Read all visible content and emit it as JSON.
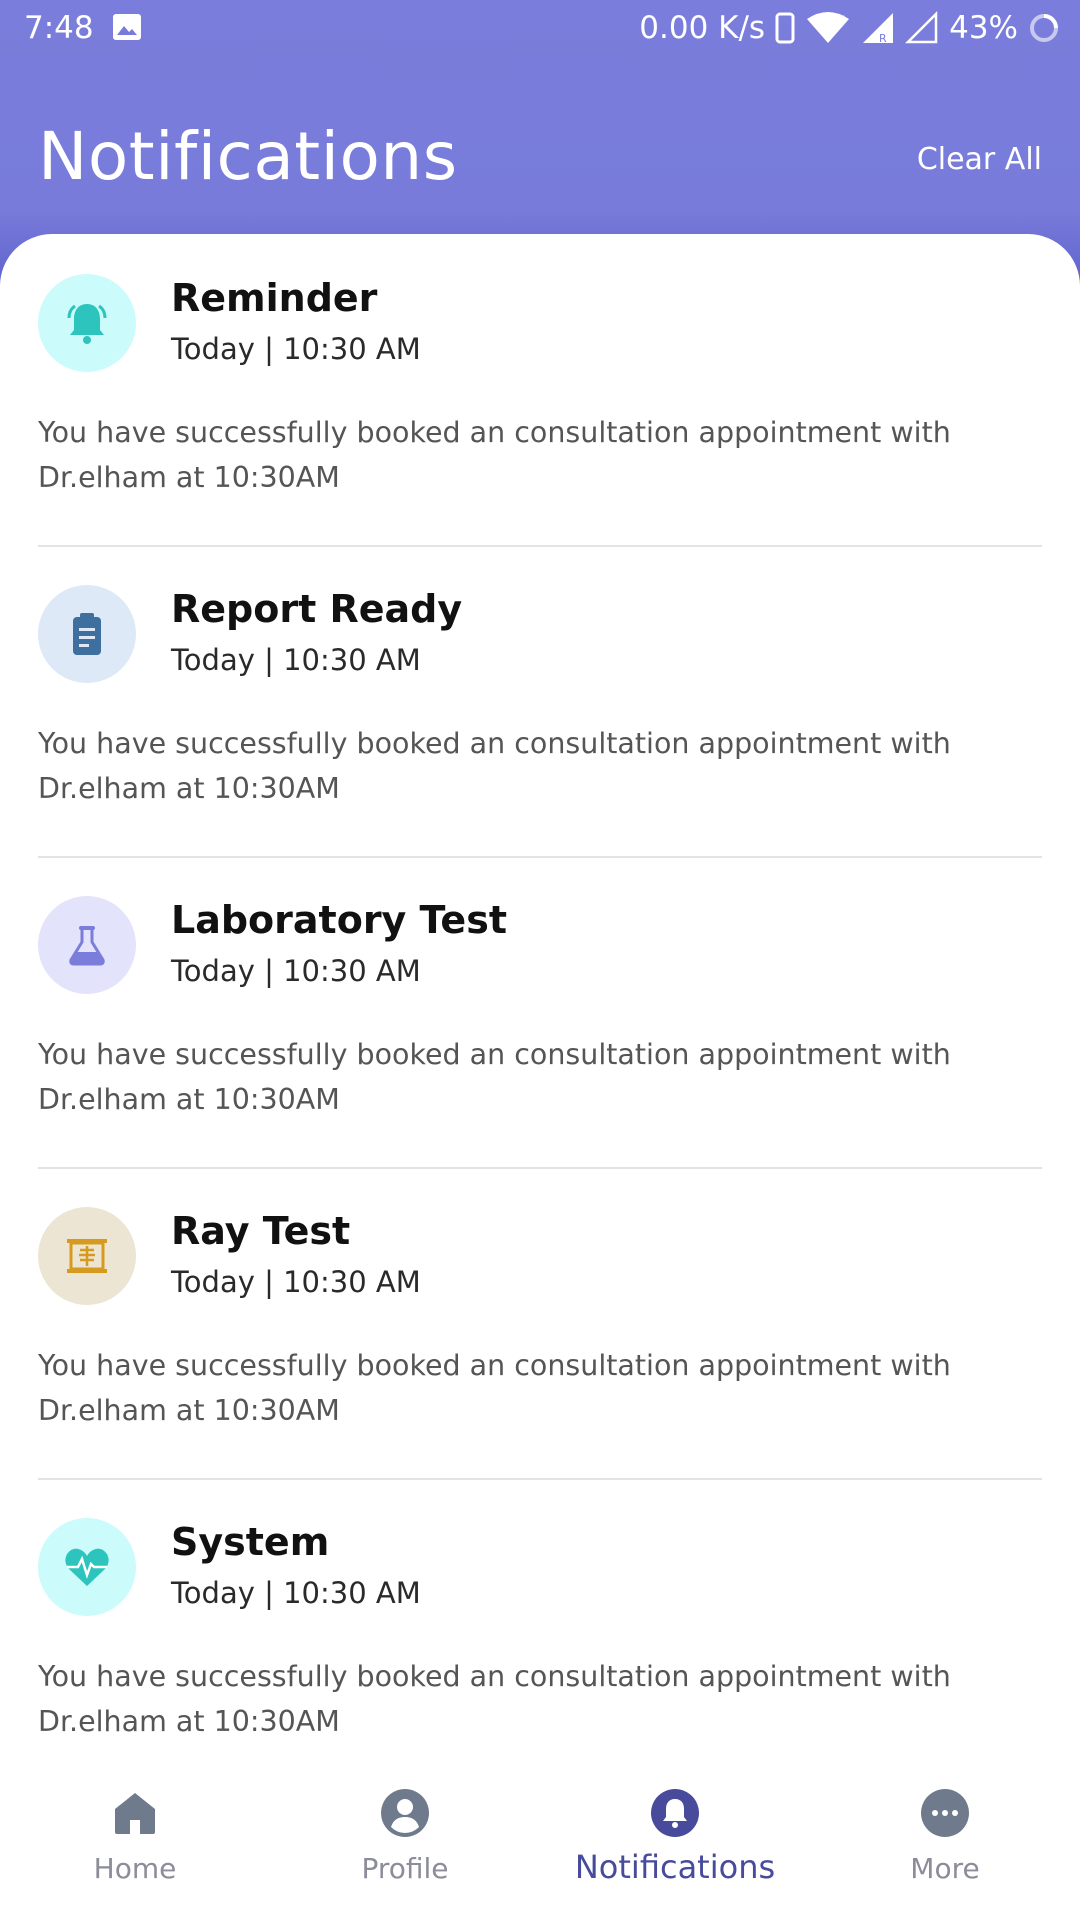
{
  "status_bar": {
    "time": "7:48",
    "speed": "0.00 K/s",
    "battery": "43%",
    "icons": [
      "gallery-icon",
      "phone-icon",
      "wifi-icon",
      "signal-icon",
      "signal-empty-icon",
      "loading-icon"
    ]
  },
  "header": {
    "title": "Notifications",
    "clear_all": "Clear All"
  },
  "colors": {
    "header": "#787bd9",
    "accent": "#484b9c",
    "inactive_tab": "#8c8c9a"
  },
  "notifications": [
    {
      "title": "Reminder",
      "time": "Today | 10:30 AM",
      "message": "You have successfully booked an consultation appointment with Dr.elham at 10:30AM",
      "icon": "bell-icon",
      "icon_bg": "#ccfbfb",
      "icon_color": "#2cc4bc"
    },
    {
      "title": "Report Ready",
      "time": "Today | 10:30 AM",
      "message": "You have successfully booked an consultation appointment with Dr.elham at 10:30AM",
      "icon": "clipboard-icon",
      "icon_bg": "#dde9f6",
      "icon_color": "#3e6f9e"
    },
    {
      "title": "Laboratory Test",
      "time": "Today | 10:30 AM",
      "message": "You have successfully booked an consultation appointment with Dr.elham at 10:30AM",
      "icon": "flask-icon",
      "icon_bg": "#e3e3fb",
      "icon_color": "#7b7ddb"
    },
    {
      "title": "Ray Test",
      "time": "Today | 10:30 AM",
      "message": "You have successfully booked an consultation appointment with Dr.elham at 10:30AM",
      "icon": "xray-icon",
      "icon_bg": "#ece5d3",
      "icon_color": "#d69a1e"
    },
    {
      "title": "System",
      "time": "Today | 10:30 AM",
      "message": "You have successfully booked an consultation appointment with Dr.elham at 10:30AM",
      "icon": "heartbeat-icon",
      "icon_bg": "#ccfbfb",
      "icon_color": "#2cc4bc"
    }
  ],
  "bottom_nav": [
    {
      "label": "Home",
      "icon": "home-icon",
      "active": false
    },
    {
      "label": "Profile",
      "icon": "profile-icon",
      "active": false
    },
    {
      "label": "Notifications",
      "icon": "bell-icon",
      "active": true
    },
    {
      "label": "More",
      "icon": "more-icon",
      "active": false
    }
  ]
}
